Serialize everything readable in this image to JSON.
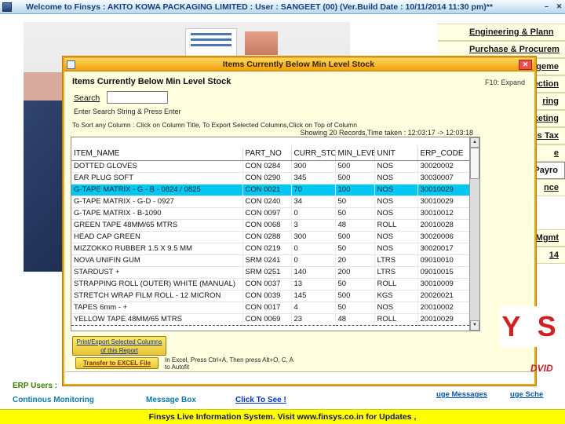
{
  "window": {
    "title": "Welcome to Finsys : AKITO KOWA PACKAGING LIMITED : User : SANGEET (00) (Ver.Build Date : 10/11/2014 11:30 pm)**",
    "minimize_glyph": "–",
    "close_glyph": "✕"
  },
  "menu": {
    "items": [
      {
        "label": "Engineering & Plann"
      },
      {
        "label": "Purchase & Procurem"
      },
      {
        "label": "ageme"
      },
      {
        "label": "ection"
      },
      {
        "label": "ring"
      },
      {
        "label": "keting"
      },
      {
        "label": "es Tax"
      },
      {
        "label": "e"
      },
      {
        "label": "Payro"
      },
      {
        "label": "nce"
      },
      {
        "label": "Mgmt"
      },
      {
        "label": "14"
      }
    ]
  },
  "dialog": {
    "titlebar": {
      "title": "Items Currently Below Min Level Stock",
      "close_glyph": "✕"
    },
    "header": "Items Currently Below Min Level Stock",
    "expand_hint": "F10: Expand",
    "search": {
      "label": "Search",
      "value": "",
      "hint": "Enter Search String & Press Enter"
    },
    "sort_hint": "To Sort any Column : Click on Column Title, To Export Selected Columns,Click on Top of Column",
    "records_info": "Showing 20 Records,Time taken : 12:03:17 -> 12:03:18",
    "table": {
      "columns": [
        "ITEM_NAME",
        "PART_NO",
        "CURR_STOC",
        "MIN_LEVEL",
        "UNIT",
        "ERP_CODE"
      ],
      "selected_row": 2,
      "focused_row": 13,
      "rows": [
        [
          "DOTTED GLOVES",
          "CON 0284",
          "300",
          "500",
          "NOS",
          "30020002"
        ],
        [
          "EAR PLUG SOFT",
          "CON 0290",
          "345",
          "500",
          "NOS",
          "30030007"
        ],
        [
          "G-TAPE MATRIX - G - B - 0824 / 0825",
          "CON 0021",
          "70",
          "100",
          "NOS",
          "30010029"
        ],
        [
          "G-TAPE MATRIX - G-D - 0927",
          "CON 0240",
          "34",
          "50",
          "NOS",
          "30010029"
        ],
        [
          "G-TAPE MATRIX - B-1090",
          "CON 0097",
          "0",
          "50",
          "NOS",
          "30010012"
        ],
        [
          "GREEN TAPE 48MM/65 MTRS",
          "CON 0068",
          "3",
          "48",
          "ROLL",
          "20010028"
        ],
        [
          "HEAD CAP GREEN",
          "CON 0288",
          "300",
          "500",
          "NOS",
          "30020006"
        ],
        [
          "MIZZOKKO RUBBER 1.5 X 9.5 MM",
          "CON 0219",
          "0",
          "50",
          "NOS",
          "30020017"
        ],
        [
          "NOVA UNIFIN GUM",
          "SRM 0241",
          "0",
          "20",
          "LTRS",
          "09010010"
        ],
        [
          "STARDUST +",
          "SRM 0251",
          "140",
          "200",
          "LTRS",
          "09010015"
        ],
        [
          "STRAPPING ROLL (OUTER) WHITE (MANUAL)",
          "CON 0037",
          "13",
          "50",
          "ROLL",
          "30010009"
        ],
        [
          "STRETCH WRAP FILM ROLL - 12 MICRON",
          "CON 0039",
          "145",
          "500",
          "KGS",
          "20020021"
        ],
        [
          "TAPES 6mm - +",
          "CON 0017",
          "4",
          "50",
          "NOS",
          "20010002"
        ],
        [
          "YELLOW TAPE 48MM/65 MTRS",
          "CON 0069",
          "23",
          "48",
          "ROLL",
          "20010029"
        ]
      ]
    },
    "scrollbar": {
      "up": "▲",
      "down": "▼"
    },
    "buttons": {
      "print_label": "Print/Export Selected Columns of this Report",
      "excel_label": "Transfer to EXCEL File",
      "excel_hint": "In Excel, Press Ctrl+A, Then press Alt+O, C, A to Autofit"
    }
  },
  "logo": {
    "text": "Y S",
    "fragment": "DVID"
  },
  "footer": {
    "erp_users": "ERP Users :",
    "monitoring": "Continous Monitoring",
    "message_box": "Message Box",
    "click_to_see": "Click To See !",
    "link_messages": "uge Messages",
    "link_schedule": "uge Sche",
    "status_bar": "Finsys Live Information System. Visit www.finsys.co.in for Updates ,"
  },
  "colors": {
    "dialog_title_bar": "#f09e06",
    "highlight_row": "#00c8f2",
    "status_bar": "#ffff00",
    "close_button": "#ee4f4f"
  }
}
